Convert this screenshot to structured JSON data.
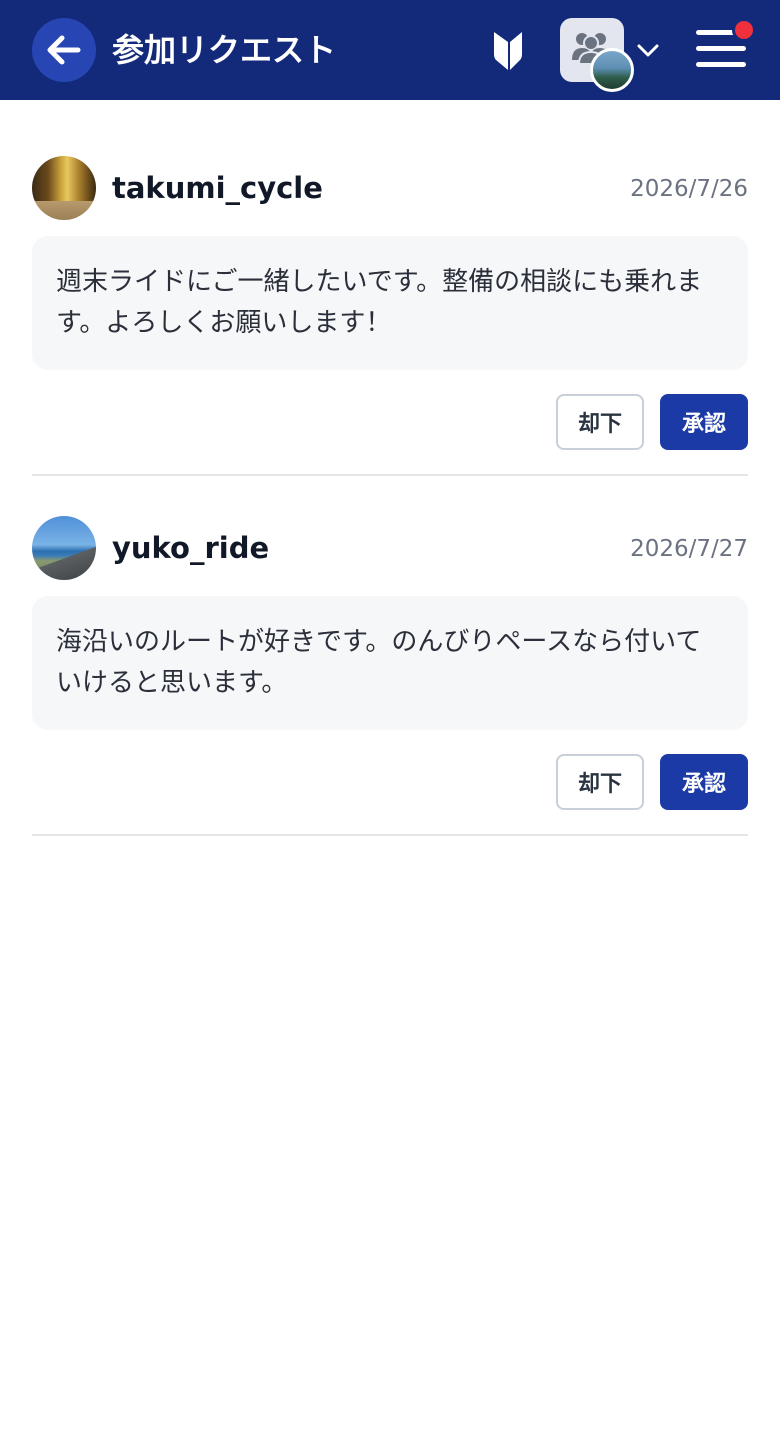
{
  "header": {
    "title": "参加リクエスト",
    "back_icon": "arrow-left-icon",
    "shield_icon": "shield-icon",
    "team_icon": "users-icon",
    "chevron_icon": "chevron-down-icon",
    "menu_icon": "hamburger-menu-icon",
    "notification_dot_color": "#f0303c",
    "bar_color": "#13297a"
  },
  "requests": [
    {
      "username": "takumi_cycle",
      "date": "2026/7/26",
      "message": "週末ライドにご一緒したいです。整備の相談にも乗れます。よろしくお願いします！",
      "reject_label": "却下",
      "approve_label": "承認"
    },
    {
      "username": "yuko_ride",
      "date": "2026/7/27",
      "message": "海沿いのルートが好きです。のんびりペースなら付いていけると思います。",
      "reject_label": "却下",
      "approve_label": "承認"
    }
  ],
  "colors": {
    "accent": "#1c3aa6",
    "header": "#13297a",
    "message_bg": "#f6f7f9"
  }
}
